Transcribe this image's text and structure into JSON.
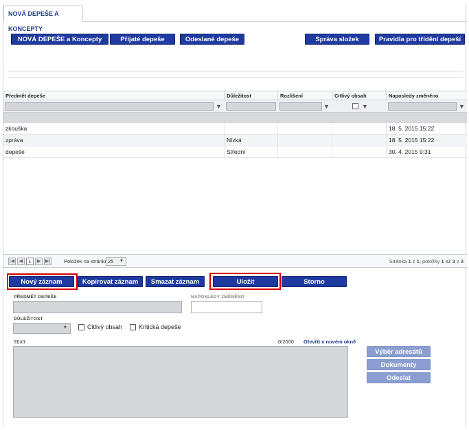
{
  "tabs": [
    {
      "label": "NOVÁ DEPEŠE A KONCEPTY"
    }
  ],
  "toolbar": {
    "btn_new_and_drafts": "NOVÁ DEPEŠE a Koncepty",
    "btn_received": "Přijaté depeše",
    "btn_sent": "Odeslané depeše",
    "btn_folders": "Správa složek",
    "btn_rules": "Pravidla pro třídění depeší"
  },
  "grid": {
    "columns": [
      "Předmět depeše",
      "Důležitost",
      "Rozlišení",
      "Citlivý obsah",
      "Naposledy změněno"
    ],
    "rows": [
      {
        "subject": "zkouška",
        "importance": "",
        "resolution": "",
        "sensitive": "",
        "modified": "18. 5. 2015 15:22"
      },
      {
        "subject": "zpráva",
        "importance": "Nízká",
        "resolution": "",
        "sensitive": "",
        "modified": "18. 5. 2015 15:22"
      },
      {
        "subject": "depeše",
        "importance": "Střední",
        "resolution": "",
        "sensitive": "",
        "modified": "30. 4. 2015 9:31"
      }
    ]
  },
  "pager": {
    "first": "|◀",
    "prev": "◀",
    "page": "1",
    "next": "▶",
    "last": "▶|",
    "per_page_label": "Položek na stránku",
    "per_page_value": "25",
    "info_prefix": "Stránka ",
    "info_page": "1",
    "info_mid1": " z ",
    "info_pages": "1",
    "info_mid2": ", položky ",
    "info_from": "1",
    "info_mid3": " až ",
    "info_to": "3",
    "info_mid4": " z ",
    "info_total": "3"
  },
  "actions": {
    "new": "Nový záznam",
    "copy": "Kopírovat záznam",
    "delete": "Smazat záznam",
    "save": "Uložit",
    "cancel": "Storno"
  },
  "form": {
    "subject_label": "PŘEDMĚT DEPEŠE",
    "modified_label": "NAPOSLEDY ZMĚNĚNO",
    "importance_label": "DŮLEŽITOST",
    "sensitive_label": "Citlivý obsah",
    "critical_label": "Kritická depeše",
    "text_label": "TEXT",
    "char_count": "0/2000",
    "open_new_window": "Otevřít v novém okně"
  },
  "side_buttons": {
    "recipients": "Výběr adresátů",
    "documents": "Dokumenty",
    "send": "Odeslat"
  },
  "colors": {
    "primary": "#1f3aa0",
    "disabled": "#8a9ed2",
    "highlight": "#d40000"
  }
}
